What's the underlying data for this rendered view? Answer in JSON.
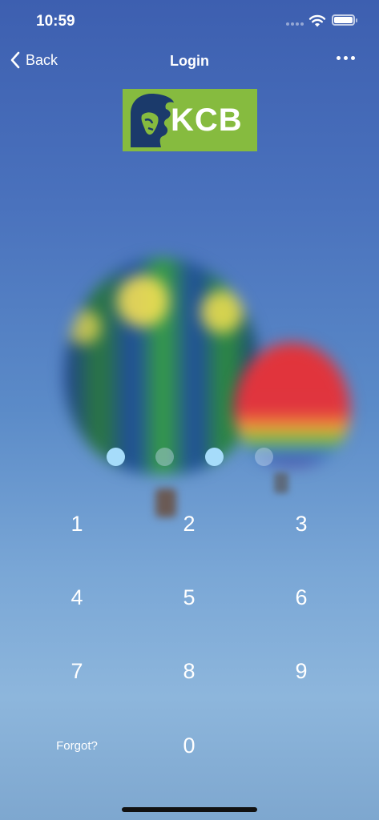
{
  "status_bar": {
    "time": "10:59",
    "icons": [
      "cellular-signal-icon",
      "wifi-icon",
      "battery-icon"
    ]
  },
  "nav": {
    "back_label": "Back",
    "title": "Login",
    "more_icon": "ellipsis-icon"
  },
  "logo": {
    "text": "KCB",
    "icon": "lion-logo-icon",
    "colors": {
      "background": "#86bb3f",
      "lion": "#1b3a6b"
    }
  },
  "pin": {
    "digits_entered": 2,
    "total_digits": 4,
    "states": [
      "filled",
      "empty",
      "filled",
      "empty"
    ]
  },
  "keypad": {
    "keys": [
      "1",
      "2",
      "3",
      "4",
      "5",
      "6",
      "7",
      "8",
      "9"
    ],
    "forgot_label": "Forgot?",
    "zero_label": "0"
  },
  "colors": {
    "pin_filled": "#a6dcfa",
    "text": "#ffffff"
  }
}
